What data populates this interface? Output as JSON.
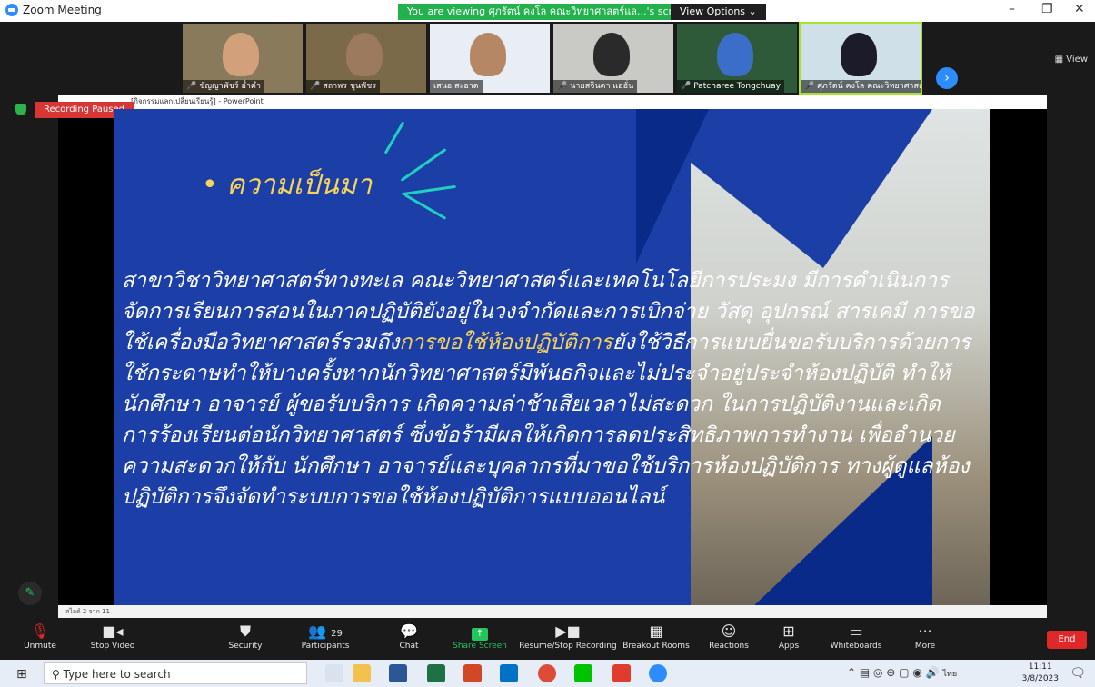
{
  "window": {
    "title": "Zoom Meeting",
    "minimize": "–",
    "restore": "❐",
    "close": "✕"
  },
  "share_banner": {
    "text": "You are viewing ศุภรัตน์ คงโล คณะวิทยาศาสตร์แล...'s screen",
    "view_options": "View Options"
  },
  "top_view_label": "View",
  "participants": [
    {
      "name": "ชัญญาพัชร์ อ่ำคำ",
      "muted": true
    },
    {
      "name": "สถาพร ขุนพัชร",
      "muted": true
    },
    {
      "name": "เสนอ สะอาด",
      "muted": false
    },
    {
      "name": "นายสจินดา แอ่ฮั่น",
      "muted": true
    },
    {
      "name": "Patcharee Tongchuay",
      "muted": true
    },
    {
      "name": "ศุภรัตน์ คงโล คณะวิทยาศาสต...",
      "muted": true
    }
  ],
  "ppt": {
    "title": "[กิจกรรมแลกเปลี่ยนเรียนรู้] - PowerPoint",
    "status": "สไลด์ 2 จาก 11"
  },
  "recording_badge": "Recording Paused",
  "slide": {
    "heading": "• ความเป็นมา",
    "body_line1": "สาขาวิชาวิทยาศาสตร์ทางทะเล คณะวิทยาศาสตร์และเทคโนโลยีการประมง มีการดำเนินการจัดการเรียนการสอนในภาคปฏิบัติยังอยู่ในวงจำกัดและการเบิกจ่าย วัสดุ อุปกรณ์ สารเคมี การขอใช้เครื่องมือวิทยาศาสตร์รวมถึง",
    "highlight": "การขอใช้ห้องปฏิบัติการ",
    "body_line2": "ยังใช้วิธีการแบบยื่นขอรับบริการด้วยการใช้กระดาษทำให้บางครั้งหากนักวิทยาศาสตร์มีพันธกิจและไม่ประจำอยู่ประจำห้องปฏิบัติ ทำให้นักศึกษา อาจารย์ ผู้ขอรับบริการ เกิดความล่าช้าเสียเวลาไม่สะดวก ในการปฏิบัติงานและเกิดการร้องเรียนต่อนักวิทยาศาสตร์ ซึ่งข้อร้ามีผลให้เกิดการลดประสิทธิภาพการทำงาน เพื่ออำนวยความสะดวกให้กับ นักศึกษา อาจารย์และบุคลากรที่มาขอใช้บริการห้องปฏิบัติการ ทางผู้ดูแลห้องปฏิบัติการจึงจัดทำระบบการขอใช้ห้องปฏิบัติการแบบออนไลน์"
  },
  "toolbar": {
    "unmute": "Unmute",
    "stop_video": "Stop Video",
    "security": "Security",
    "participants": "Participants",
    "participants_count": "29",
    "chat": "Chat",
    "share_screen": "Share Screen",
    "recording": "Resume/Stop Recording",
    "breakout": "Breakout Rooms",
    "reactions": "Reactions",
    "apps": "Apps",
    "whiteboards": "Whiteboards",
    "more": "More",
    "end": "End"
  },
  "taskbar": {
    "search_placeholder": "Type here to search",
    "time": "11:11",
    "date": "3/8/2023",
    "lang": "ไทย"
  },
  "colors": {
    "slide_bg": "#1b3fa6",
    "heading": "#f7d35b",
    "accent_green": "#22c55e",
    "record_red": "#d83535"
  }
}
